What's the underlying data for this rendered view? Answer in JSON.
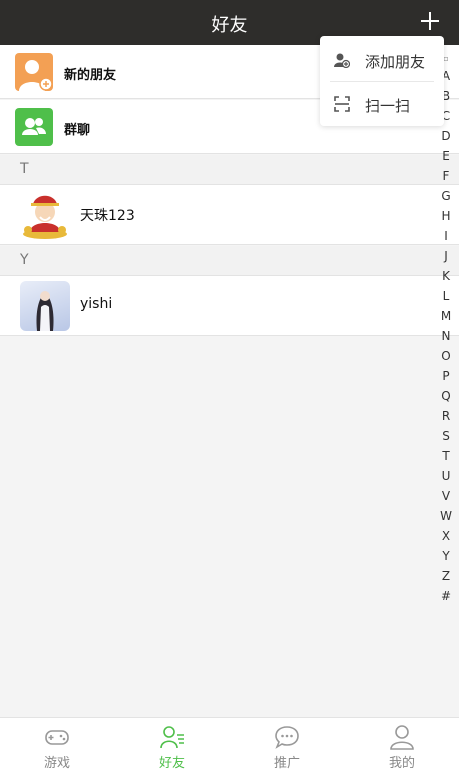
{
  "header": {
    "title": "好友"
  },
  "entries": {
    "new_friends": "新的朋友",
    "group_chat": "群聊"
  },
  "sections": [
    {
      "letter": "T",
      "friends": [
        {
          "name": "天珠123"
        }
      ]
    },
    {
      "letter": "Y",
      "friends": [
        {
          "name": "yishi"
        }
      ]
    }
  ],
  "popup": {
    "add_friend": "添加朋友",
    "scan": "扫一扫"
  },
  "index_letters": [
    "A",
    "B",
    "C",
    "D",
    "E",
    "F",
    "G",
    "H",
    "I",
    "J",
    "K",
    "L",
    "M",
    "N",
    "O",
    "P",
    "Q",
    "R",
    "S",
    "T",
    "U",
    "V",
    "W",
    "X",
    "Y",
    "Z",
    "#"
  ],
  "tabs": [
    {
      "label": "游戏",
      "icon": "gamepad-icon"
    },
    {
      "label": "好友",
      "icon": "friends-icon",
      "active": true
    },
    {
      "label": "推广",
      "icon": "chat-bubble-icon"
    },
    {
      "label": "我的",
      "icon": "user-icon"
    }
  ],
  "colors": {
    "header_bg": "#2e2d2b",
    "accent": "#4fbf4a",
    "new_friend_icon": "#f3a054"
  }
}
